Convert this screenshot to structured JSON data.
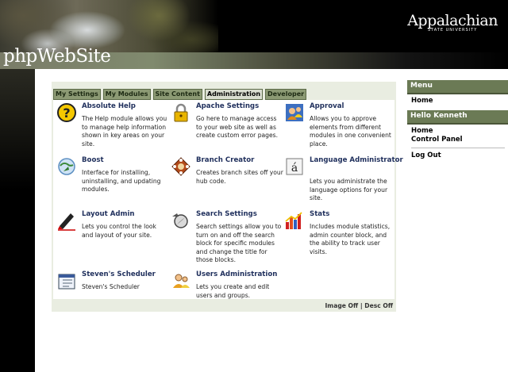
{
  "header": {
    "site_title": "phpWebSite",
    "logo_main": "Appalachian",
    "logo_sub": "STATE UNIVERSITY"
  },
  "tabs": [
    {
      "label": "My Settings",
      "active": false
    },
    {
      "label": "My Modules",
      "active": false
    },
    {
      "label": "Site Content",
      "active": false
    },
    {
      "label": "Administration",
      "active": true
    },
    {
      "label": "Developer",
      "active": false
    }
  ],
  "modules": [
    {
      "title": "Absolute Help",
      "description": "The Help module allows you to manage help information shown in key areas on your site.",
      "icon": "help-question-icon"
    },
    {
      "title": "Apache Settings",
      "description": "Go here to manage access to your web site as well as create custom error pages.",
      "icon": "padlock-icon"
    },
    {
      "title": "Approval",
      "description": "Allows you to approve elements from different modules in one convenient place.",
      "icon": "approval-users-icon"
    },
    {
      "title": "Boost",
      "description": "Interface for installing, uninstalling, and updating modules.",
      "icon": "boost-globe-icon"
    },
    {
      "title": "Branch Creator",
      "description": "Creates branch sites off your hub code.",
      "icon": "branch-icon"
    },
    {
      "title": "Language Administrator",
      "description": "Lets you administrate the language options for your site.",
      "icon": "language-icon"
    },
    {
      "title": "Layout Admin",
      "description": "Lets you control the look and layout of your site.",
      "icon": "layout-pen-icon"
    },
    {
      "title": "Search Settings",
      "description": "Search settings allow you to turn on and off the search block for specific modules and change the title for those blocks.",
      "icon": "search-compass-icon"
    },
    {
      "title": "Stats",
      "description": "Includes module statistics, admin counter block, and the ability to track user visits.",
      "icon": "stats-chart-icon"
    },
    {
      "title": "Steven's Scheduler",
      "description": "Steven's Scheduler",
      "icon": "scheduler-calendar-icon"
    },
    {
      "title": "Users Administration",
      "description": "Lets you create and edit users and groups.",
      "icon": "users-admin-icon"
    }
  ],
  "footer": {
    "image_off": "Image Off",
    "separator": "|",
    "desc_off": "Desc Off"
  },
  "sidebar": {
    "menu_title": "Menu",
    "menu_home": "Home",
    "hello_title": "Hello Kenneth",
    "home": "Home",
    "control_panel": "Control Panel",
    "logout": "Log Out"
  }
}
